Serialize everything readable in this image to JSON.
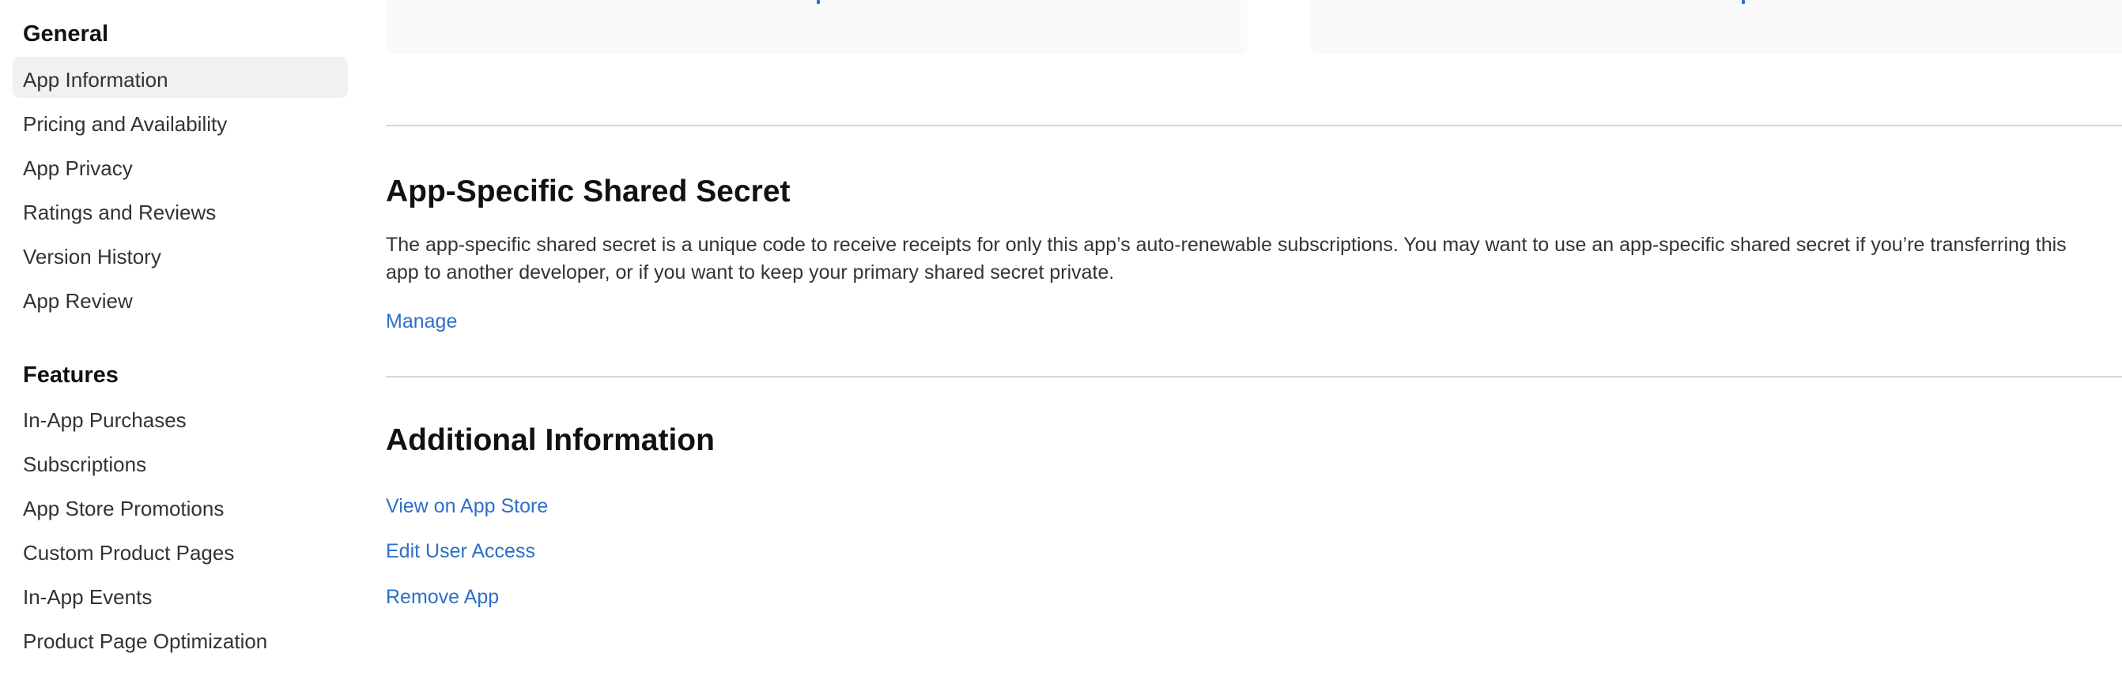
{
  "sidebar": {
    "sections": [
      {
        "heading": "General",
        "items": [
          {
            "label": "App Information",
            "selected": true
          },
          {
            "label": "Pricing and Availability",
            "selected": false
          },
          {
            "label": "App Privacy",
            "selected": false
          },
          {
            "label": "Ratings and Reviews",
            "selected": false
          },
          {
            "label": "Version History",
            "selected": false
          },
          {
            "label": "App Review",
            "selected": false
          }
        ]
      },
      {
        "heading": "Features",
        "items": [
          {
            "label": "In-App Purchases",
            "selected": false
          },
          {
            "label": "Subscriptions",
            "selected": false
          },
          {
            "label": "App Store Promotions",
            "selected": false
          },
          {
            "label": "Custom Product Pages",
            "selected": false
          },
          {
            "label": "In-App Events",
            "selected": false
          },
          {
            "label": "Product Page Optimization",
            "selected": false
          }
        ]
      }
    ]
  },
  "main": {
    "shared_secret": {
      "title": "App-Specific Shared Secret",
      "description": "The app-specific shared secret is a unique code to receive receipts for only this app’s auto-renewable subscriptions. You may want to use an app-specific shared secret if you’re transferring this app to another developer, or if you want to keep your primary shared secret private.",
      "manage_label": "Manage"
    },
    "additional_info": {
      "title": "Additional Information",
      "links": [
        {
          "label": "View on App Store"
        },
        {
          "label": "Edit User Access"
        },
        {
          "label": "Remove App"
        }
      ]
    }
  },
  "colors": {
    "link": "#2d6fc8",
    "selected_bg": "#f1f1f1",
    "card_bg": "#fafafa",
    "divider": "#d6d6d6"
  }
}
